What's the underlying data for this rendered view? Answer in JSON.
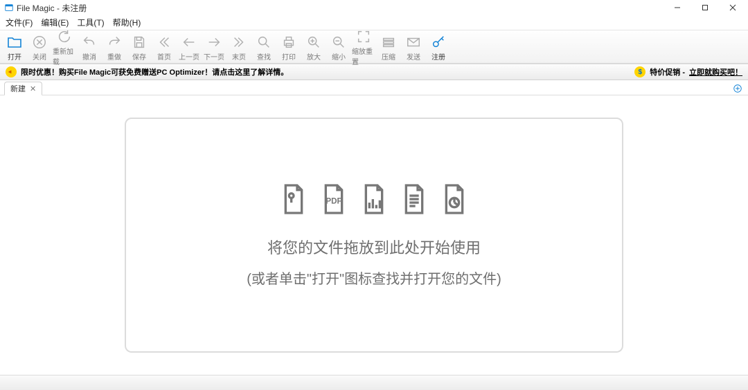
{
  "window": {
    "title": "File Magic - 未注册"
  },
  "menu": {
    "file": "文件(F)",
    "edit": "编辑(E)",
    "tools": "工具(T)",
    "help": "帮助(H)"
  },
  "toolbar": [
    {
      "id": "open",
      "label": "打开",
      "enabled": true
    },
    {
      "id": "close",
      "label": "关闭",
      "enabled": false
    },
    {
      "id": "reload",
      "label": "重新加载",
      "enabled": false
    },
    {
      "id": "undo",
      "label": "撤消",
      "enabled": false
    },
    {
      "id": "redo",
      "label": "重做",
      "enabled": false
    },
    {
      "id": "save",
      "label": "保存",
      "enabled": false
    },
    {
      "id": "first",
      "label": "首页",
      "enabled": false
    },
    {
      "id": "prev",
      "label": "上一页",
      "enabled": false
    },
    {
      "id": "next",
      "label": "下一页",
      "enabled": false
    },
    {
      "id": "last",
      "label": "末页",
      "enabled": false
    },
    {
      "id": "find",
      "label": "查找",
      "enabled": false
    },
    {
      "id": "print",
      "label": "打印",
      "enabled": false
    },
    {
      "id": "zoomin",
      "label": "放大",
      "enabled": false
    },
    {
      "id": "zoomout",
      "label": "缩小",
      "enabled": false
    },
    {
      "id": "zoomreset",
      "label": "缩放重置",
      "enabled": false
    },
    {
      "id": "compress",
      "label": "压缩",
      "enabled": false
    },
    {
      "id": "send",
      "label": "发送",
      "enabled": false
    },
    {
      "id": "register",
      "label": "注册",
      "enabled": true
    }
  ],
  "promo": {
    "left": "限时优惠！购买File Magic可获免费赠送PC Optimizer！请点击这里了解详情。",
    "right_label": "特价促销 -",
    "right_action": "立即就购买吧！"
  },
  "tabs": {
    "active": "新建"
  },
  "dropzone": {
    "line1": "将您的文件拖放到此处开始使用",
    "line2": "(或者单击\"打开\"图标查找并打开您的文件)"
  }
}
